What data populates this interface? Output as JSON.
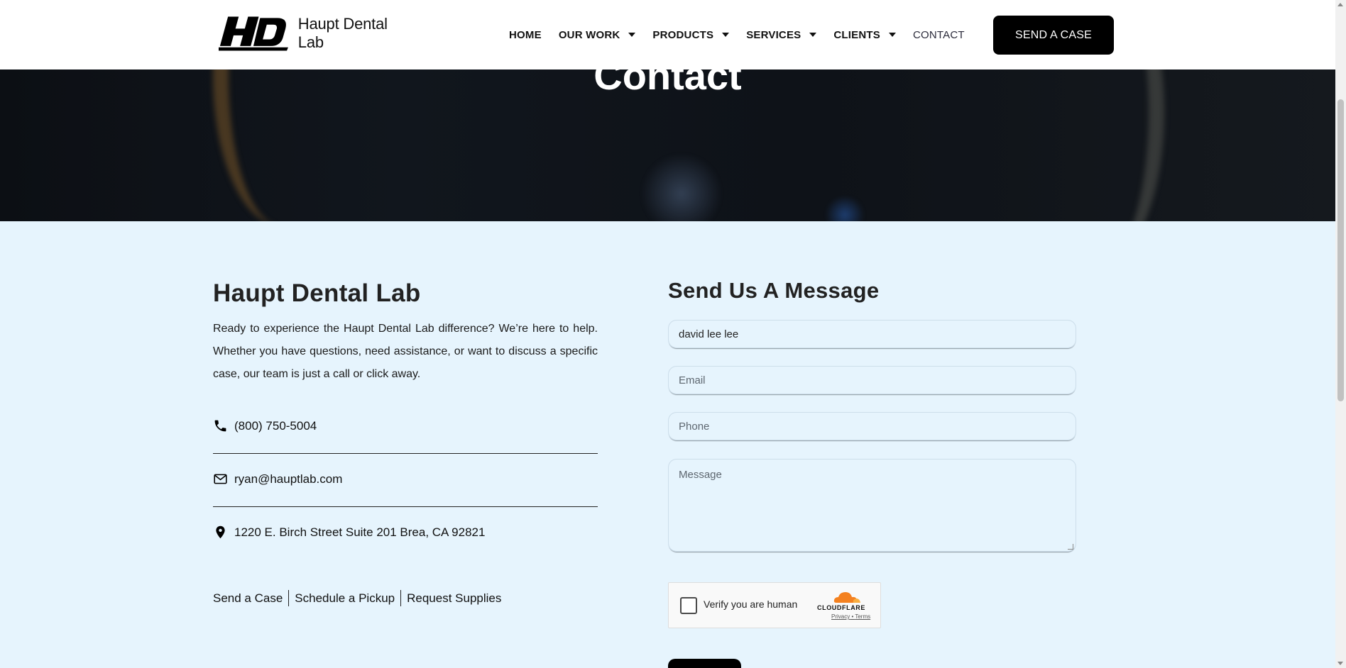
{
  "header": {
    "logo_text": "Haupt Dental Lab",
    "logo_mark": "HD",
    "nav": [
      {
        "label": "HOME",
        "has_dropdown": false
      },
      {
        "label": "OUR WORK",
        "has_dropdown": true
      },
      {
        "label": "PRODUCTS",
        "has_dropdown": true
      },
      {
        "label": "SERVICES",
        "has_dropdown": true
      },
      {
        "label": "CLIENTS",
        "has_dropdown": true
      },
      {
        "label": "CONTACT",
        "has_dropdown": false
      }
    ],
    "cta_label": "SEND A CASE"
  },
  "hero": {
    "title": "Contact"
  },
  "left": {
    "heading": "Haupt Dental Lab",
    "intro": "Ready to experience the Haupt Dental Lab difference? We’re here to help. Whether you have questions, need assistance, or want to discuss a specific case, our team is just a call or click away.",
    "phone": "(800) 750-5004",
    "email": "ryan@hauptlab.com",
    "address": "1220 E. Birch Street Suite 201 Brea, CA 92821",
    "links": [
      "Send a Case",
      "Schedule a Pickup",
      "Request Supplies"
    ]
  },
  "form": {
    "heading": "Send Us A Message",
    "name_value": "david lee lee",
    "email_placeholder": "Email",
    "phone_placeholder": "Phone",
    "message_placeholder": "Message",
    "captcha_label": "Verify you are human",
    "captcha_brand": "CLOUDFLARE",
    "captcha_privacy": "Privacy",
    "captcha_terms": "Terms"
  },
  "colors": {
    "page_bg": "#e6f4fd",
    "accent_black": "#000000",
    "cloudflare_orange": "#f48120"
  },
  "icons": [
    "phone-icon",
    "mail-icon",
    "location-pin-icon",
    "chevron-down-icon",
    "cloudflare-logo-icon"
  ]
}
